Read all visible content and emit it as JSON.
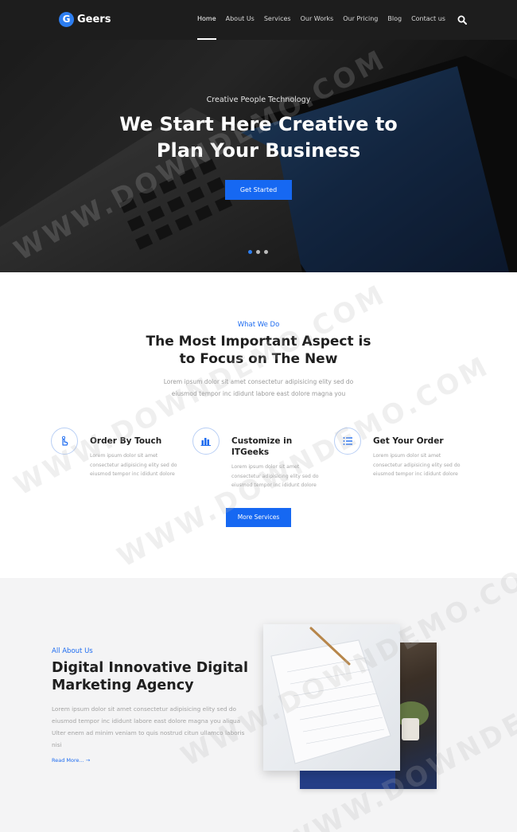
{
  "nav": {
    "logo_letter": "G",
    "logo_text": "Geers",
    "items": [
      "Home",
      "About Us",
      "Services",
      "Our Works",
      "Our Pricing",
      "Blog",
      "Contact us"
    ],
    "active_index": 0,
    "search_icon": "search-icon"
  },
  "hero": {
    "eyebrow": "Creative People Technology",
    "title_line1": "We Start Here Creative to",
    "title_line2": "Plan Your Business",
    "cta": "Get Started",
    "slide_count": 3,
    "active_slide": 0
  },
  "services": {
    "eyebrow": "What We Do",
    "title_line1": "The Most Important Aspect is",
    "title_line2": "to Focus on The New",
    "desc_line1": "Lorem ipsum dolor sit amet consectetur adipisicing elity sed do",
    "desc_line2": "eiusmod tempor inc ididunt labore east dolore magna you",
    "items": [
      {
        "icon": "touch-icon",
        "title": "Order By Touch",
        "text_lines": [
          "Lorem ipsum dolor sit amet",
          "consectetur adipisicing elity sed do",
          "eiusmod tempor inc ididunt dolore"
        ]
      },
      {
        "icon": "bar-chart-icon",
        "title": "Customize in ITGeeks",
        "text_lines": [
          "Lorem ipsum dolor sit amet",
          "consectetur adipisicing elity sed do",
          "eiusmod tempor inc ididunt dolore"
        ]
      },
      {
        "icon": "list-icon",
        "title": "Get Your Order",
        "text_lines": [
          "Lorem ipsum dolor sit amet",
          "consectetur adipisicing elity sed do",
          "eiusmod tempor inc ididunt dolore"
        ]
      }
    ],
    "more_button": "More Services"
  },
  "about": {
    "eyebrow": "All About Us",
    "title_line1": "Digital Innovative Digital",
    "title_line2": "Marketing Agency",
    "desc_lines": [
      "Lorem ipsum dolor sit amet consectetur adipisicing elity sed do",
      "eiusmod tempor inc ididunt labore east dolore magna you aliqua",
      "Ulter enem ad minim veniam to quis nostrud citun ullamco laboris",
      "nisi"
    ],
    "link": "Read More... →"
  },
  "watermark": "WWW.DOWNDEMO.COM",
  "colors": {
    "accent": "#1668f2",
    "nav_bg": "#1d1d1d",
    "about_bg": "#f4f4f5"
  }
}
